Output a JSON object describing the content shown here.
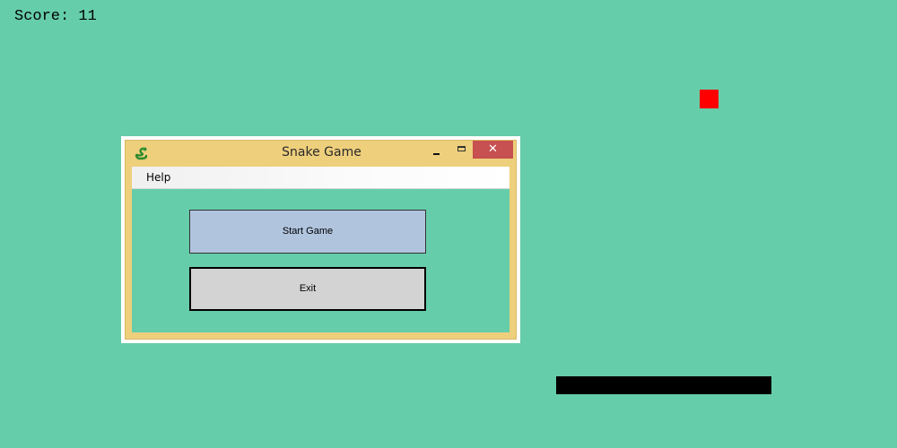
{
  "hud": {
    "score_text": "Score: 11"
  },
  "dialog": {
    "title": "Snake Game",
    "icon": "snake-icon",
    "close_glyph": "✕",
    "menu": {
      "help_label": "Help"
    },
    "buttons": {
      "start_label": "Start Game",
      "exit_label": "Exit"
    }
  },
  "colors": {
    "background": "#66CDAA",
    "food": "#FF0000",
    "snake": "#000000",
    "title_bar": "#EECF7C",
    "close_button": "#C75050",
    "start_button": "#B0C4DE",
    "exit_button": "#D3D3D3"
  }
}
